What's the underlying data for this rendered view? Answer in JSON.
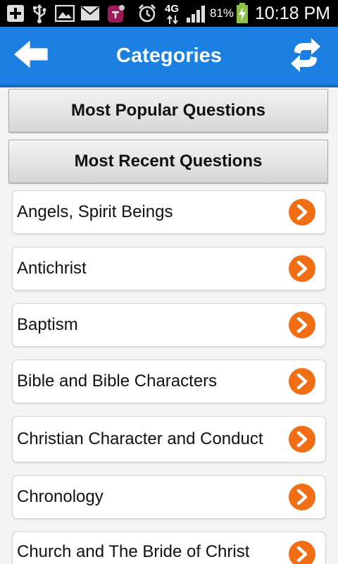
{
  "status_bar": {
    "battery": "81%",
    "network": "4G",
    "time": "10:18 PM"
  },
  "app_bar": {
    "title": "Categories"
  },
  "buttons": {
    "popular": "Most Popular Questions",
    "recent": "Most Recent Questions"
  },
  "categories": [
    {
      "label": "Angels, Spirit Beings"
    },
    {
      "label": "Antichrist"
    },
    {
      "label": "Baptism"
    },
    {
      "label": "Bible and Bible Characters"
    },
    {
      "label": "Christian Character and Conduct"
    },
    {
      "label": "Chronology"
    },
    {
      "label": "Church and The Bride of Christ"
    }
  ],
  "colors": {
    "app_bar": "#1a7fe0",
    "chevron": "#f26e14"
  },
  "icons": {
    "back": "left-arrow-icon",
    "refresh": "refresh-icon",
    "chevron": "chevron-right-icon"
  }
}
